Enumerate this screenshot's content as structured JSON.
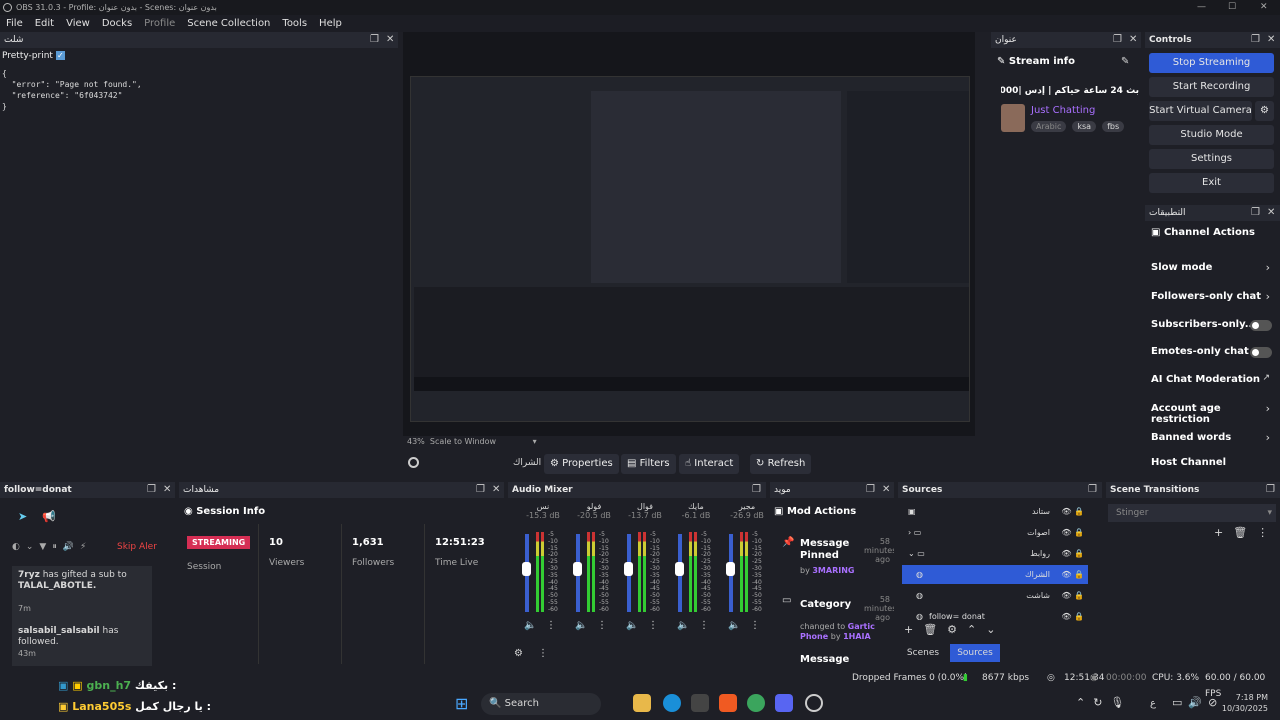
{
  "window": {
    "title": "OBS 31.0.3 - Profile: بدون عنوان - Scenes: بدون عنوان"
  },
  "menu": [
    "File",
    "Edit",
    "View",
    "Docks",
    "Profile",
    "Scene Collection",
    "Tools",
    "Help"
  ],
  "browser_dock": {
    "title": "شلت",
    "pretty_print": "Pretty-print",
    "json_text": "{\n  \"error\": \"Page not found.\",\n  \"reference\": \"6f043742\"\n}"
  },
  "preview": {
    "zoom": "43%",
    "scale": "Scale to Window",
    "source_name": "الشراك",
    "buttons": [
      "Properties",
      "Filters",
      "Interact",
      "Refresh"
    ]
  },
  "stream_info": {
    "dock_title": "عنوان",
    "header": "Stream info",
    "stream_title": "بث 24 ساعة حياكم | إدس |2000₹",
    "category": "Just Chatting",
    "tags": [
      "Arabic",
      "ksa",
      "fbs"
    ]
  },
  "controls": {
    "title": "Controls",
    "buttons": [
      "Stop Streaming",
      "Start Recording",
      "Start Virtual Camera",
      "Studio Mode",
      "Settings",
      "Exit"
    ]
  },
  "channel_actions": {
    "dock_title": "التطبيقات",
    "header": "Channel Actions",
    "items": [
      "Slow mode",
      "Followers-only chat",
      "Subscribers-only...",
      "Emotes-only chat",
      "AI Chat Moderation",
      "Account age restriction",
      "Banned words",
      "Host Channel"
    ]
  },
  "activity": {
    "dock_title": "follow=donat",
    "skip": "Skip Aler",
    "events": [
      {
        "user": "7ryz",
        "text": "has gifted a sub to",
        "target": "TALAL_ABOTLE.",
        "time": "7m"
      },
      {
        "user": "salsabil_salsabil",
        "text": "has followed.",
        "target": "",
        "time": "43m"
      }
    ]
  },
  "session": {
    "dock_title": "مشاهدات",
    "header": "Session Info",
    "badge": "STREAMING",
    "badge_sub": "Session",
    "stats": [
      {
        "value": "10",
        "label": "Viewers"
      },
      {
        "value": "1,631",
        "label": "Followers"
      },
      {
        "value": "12:51:23",
        "label": "Time Live"
      }
    ]
  },
  "mixer": {
    "title": "Audio Mixer",
    "channels": [
      {
        "name": "نس",
        "db": "-15.3 dB"
      },
      {
        "name": "فولو",
        "db": "-20.5 dB"
      },
      {
        "name": "فوال",
        "db": "-13.7 dB"
      },
      {
        "name": "مايك",
        "db": "-6.1 dB"
      },
      {
        "name": "مجير",
        "db": "-26.9 dB"
      }
    ],
    "scale": [
      "-5",
      "-10",
      "-15",
      "-20",
      "-25",
      "-30",
      "-35",
      "-40",
      "-45",
      "-50",
      "-55",
      "-60"
    ]
  },
  "mod": {
    "dock_title": "مويد",
    "header": "Mod Actions",
    "items": [
      {
        "title": "Message Pinned",
        "by": "by",
        "user": "3MARING",
        "ago": "58 minutes ago"
      },
      {
        "title": "Category",
        "desc": "changed to",
        "value": "Gartic Phone",
        "by": "by",
        "user": "1HAIA",
        "ago": "58 minutes ago"
      },
      {
        "title": "Message"
      }
    ]
  },
  "sources": {
    "title": "Sources",
    "items": [
      "ستاند",
      "اصوات",
      "روابط",
      "الشراك",
      "شاشت",
      "follow= donat"
    ],
    "tabs": [
      "Scenes",
      "Sources"
    ]
  },
  "transitions": {
    "title": "Scene Transitions",
    "selected": "Stinger"
  },
  "status": {
    "dropped": "Dropped Frames 0 (0.0%)",
    "kbps": "8677 kbps",
    "live": "12:51:34",
    "rec": "00:00:00",
    "cpu": "CPU: 3.6%",
    "fps": "60.00 / 60.00 FPS"
  },
  "chat": [
    {
      "user": "gbn_h7",
      "msg": "بكيفك :"
    },
    {
      "user": "Lana505s",
      "msg": "يا رجال كمل :"
    }
  ],
  "taskbar": {
    "search": "Search",
    "time": "7:18 PM",
    "date": "10/30/2025",
    "lang": "ع"
  }
}
